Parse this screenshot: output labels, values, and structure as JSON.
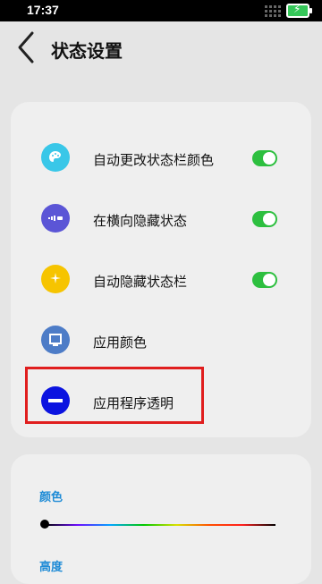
{
  "status_bar": {
    "time": "17:37"
  },
  "header": {
    "title": "状态设置"
  },
  "settings": [
    {
      "label": "自动更改状态栏颜色",
      "icon": "palette-icon",
      "toggle": true,
      "icon_color": "#39c7e8"
    },
    {
      "label": "在横向隐藏状态",
      "icon": "status-bar-icon",
      "toggle": true,
      "icon_color": "#5b55d6"
    },
    {
      "label": "自动隐藏状态栏",
      "icon": "sparkle-icon",
      "toggle": true,
      "icon_color": "#f6c400"
    },
    {
      "label": "应用颜色",
      "icon": "screen-icon",
      "toggle": null,
      "icon_color": "#4d7cc7"
    },
    {
      "label": "应用程序透明",
      "icon": "minus-circle-icon",
      "toggle": null,
      "icon_color": "#0b13e0"
    }
  ],
  "section2": {
    "color_label": "颜色",
    "height_label": "高度",
    "color_slider_value": 0
  },
  "colors": {
    "accent_toggle": "#2dbf3f",
    "highlight": "#e01e1e"
  }
}
